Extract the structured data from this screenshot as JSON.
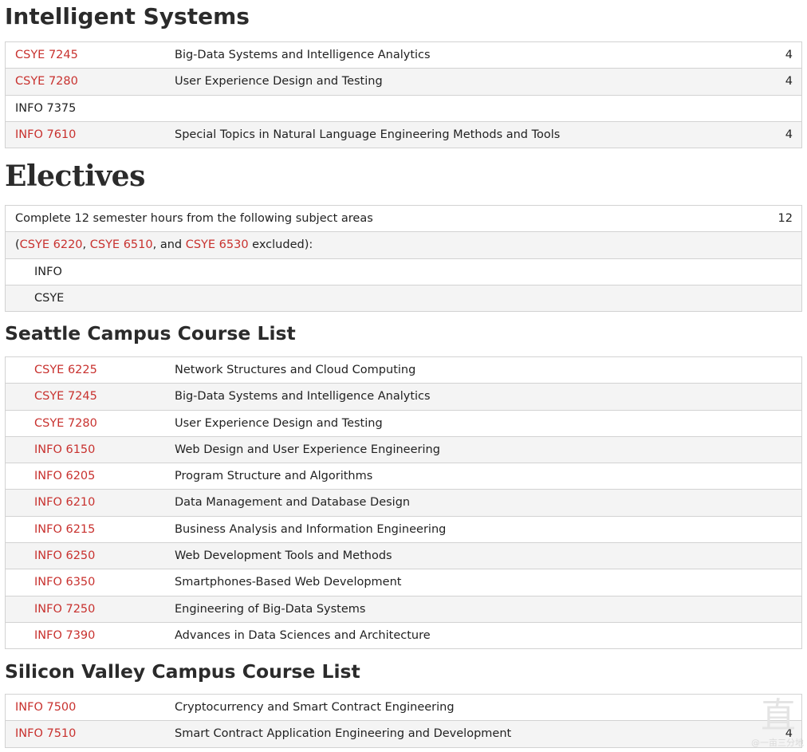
{
  "intelligent_systems": {
    "heading": "Intelligent Systems",
    "rows": [
      {
        "code": "CSYE 7245",
        "title": "Big-Data Systems and Intelligence Analytics",
        "hours": "4"
      },
      {
        "code": "CSYE 7280",
        "title": "User Experience Design and Testing",
        "hours": "4"
      },
      {
        "code": "INFO 7375",
        "title": "",
        "hours": ""
      },
      {
        "code": "INFO 7610",
        "title": "Special Topics in Natural Language Engineering Methods and Tools",
        "hours": "4"
      }
    ]
  },
  "electives": {
    "heading": "Electives",
    "complete_text": "Complete 12 semester hours from the following subject areas",
    "complete_hours": "12",
    "excluded": {
      "open": "(",
      "code1": "CSYE 6220",
      "sep1": ", ",
      "code2": "CSYE 6510",
      "sep2": ", and ",
      "code3": "CSYE 6530",
      "close": " excluded):"
    },
    "areas": [
      "INFO",
      "CSYE"
    ]
  },
  "seattle": {
    "heading": "Seattle Campus Course List",
    "rows": [
      {
        "code": "CSYE 6225",
        "title": "Network Structures and Cloud Computing"
      },
      {
        "code": "CSYE 7245",
        "title": "Big-Data Systems and Intelligence Analytics"
      },
      {
        "code": "CSYE 7280",
        "title": "User Experience Design and Testing"
      },
      {
        "code": "INFO 6150",
        "title": "Web Design and User Experience Engineering"
      },
      {
        "code": "INFO 6205",
        "title": "Program Structure and Algorithms"
      },
      {
        "code": "INFO 6210",
        "title": "Data Management and Database Design"
      },
      {
        "code": "INFO 6215",
        "title": "Business Analysis and Information Engineering"
      },
      {
        "code": "INFO 6250",
        "title": "Web Development Tools and Methods"
      },
      {
        "code": "INFO 6350",
        "title": "Smartphones-Based Web Development"
      },
      {
        "code": "INFO 7250",
        "title": "Engineering of Big-Data Systems"
      },
      {
        "code": "INFO 7390",
        "title": "Advances in Data Sciences and Architecture"
      }
    ]
  },
  "silicon_valley": {
    "heading": "Silicon Valley Campus Course List",
    "rows": [
      {
        "code": "INFO 7500",
        "title": "Cryptocurrency and Smart Contract Engineering",
        "hours": ""
      },
      {
        "code": "INFO 7510",
        "title": "Smart Contract Application Engineering and Development",
        "hours": "4"
      }
    ]
  },
  "watermark": {
    "glyph": "直",
    "text": "@一亩三分地"
  }
}
